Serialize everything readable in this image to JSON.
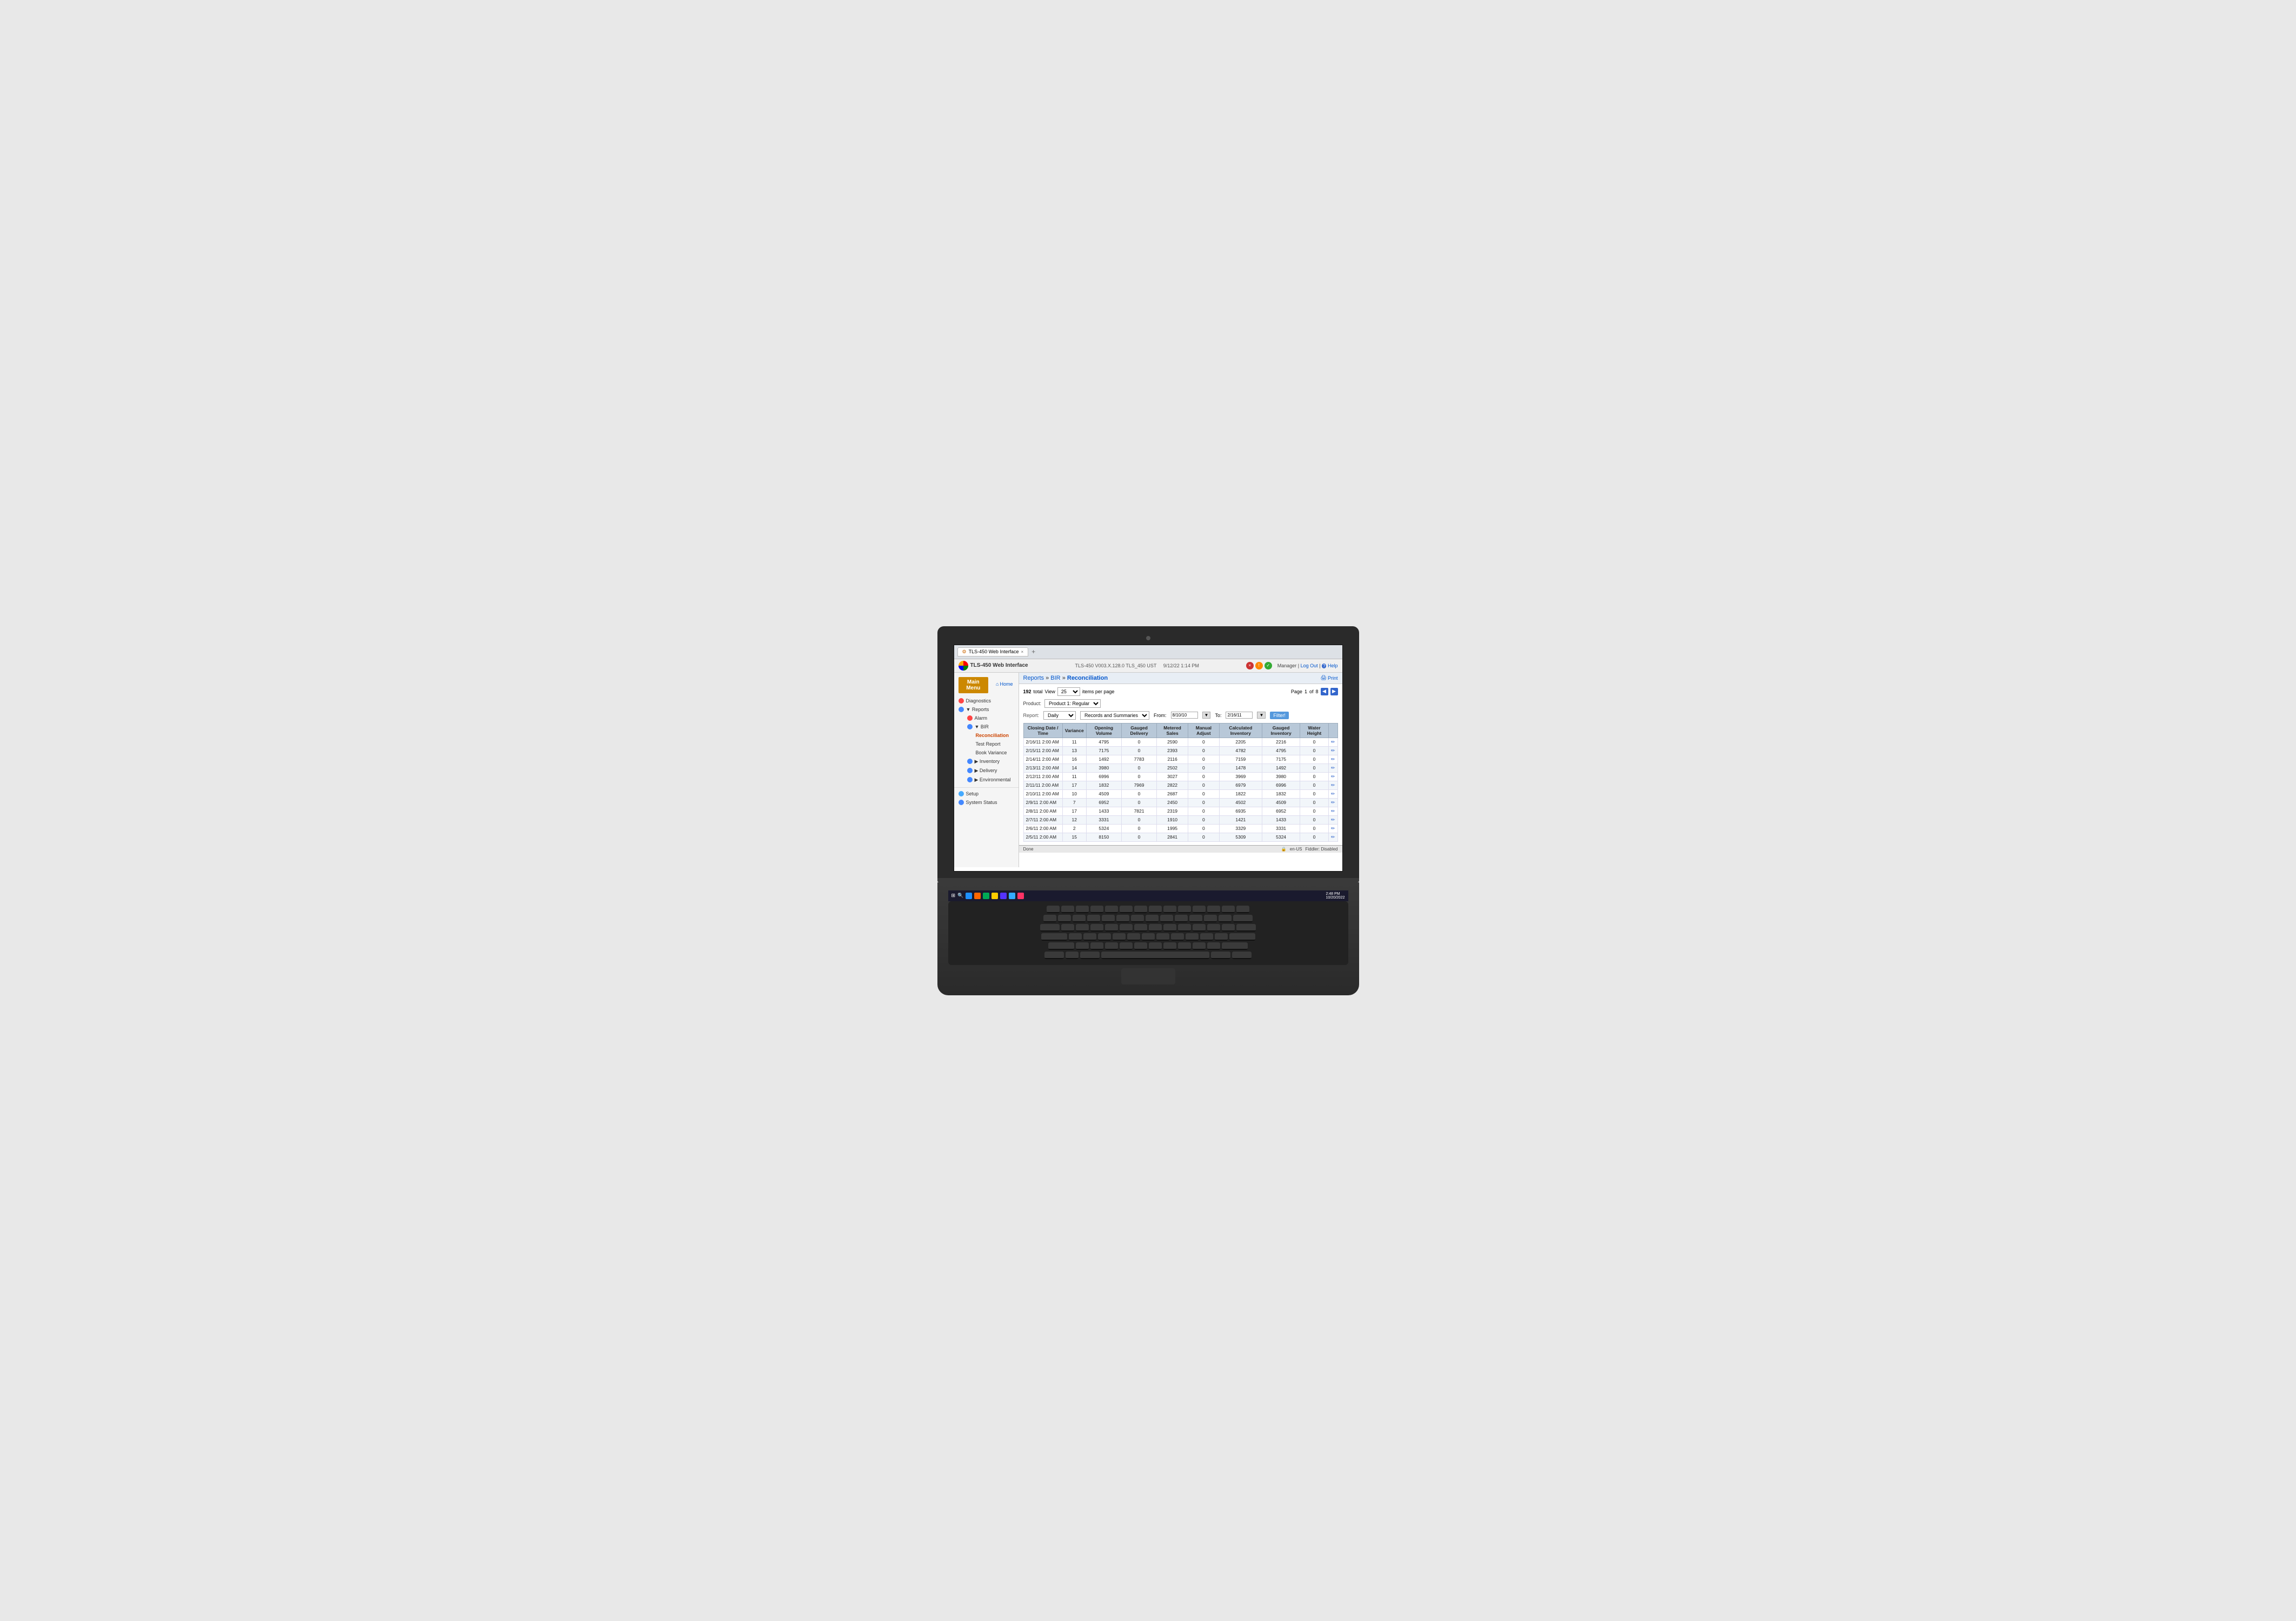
{
  "browser": {
    "tab_title": "TLS-450 Web Interface",
    "new_tab_symbol": "+",
    "close_symbol": "×"
  },
  "appbar": {
    "title": "TLS-450 Web Interface",
    "version": "TLS-450 V003.X.128.0 TLS_450 UST",
    "datetime": "9/12/22 1:14 PM",
    "user": "Manager",
    "separator": "|",
    "logout": "Log Out",
    "help": "Help",
    "help_symbol": "?",
    "status_icons": [
      "×",
      "!",
      "✓"
    ]
  },
  "nav": {
    "main_menu_label": "Main Menu",
    "home_label": "Home",
    "home_icon": "⌂"
  },
  "breadcrumb": {
    "reports": "Reports",
    "bir": "BIR",
    "current": "Reconciliation",
    "arrow": "»"
  },
  "print": {
    "label": "Print",
    "icon": "🖨"
  },
  "sidebar": {
    "items": [
      {
        "label": "Diagnostics",
        "icon": "alarm",
        "has_arrow": false,
        "indent": 0
      },
      {
        "label": "Reports",
        "icon": "reports",
        "has_arrow": true,
        "indent": 0
      },
      {
        "label": "Alarm",
        "icon": "alarm",
        "has_arrow": false,
        "indent": 1
      },
      {
        "label": "BIR",
        "icon": "bir",
        "has_arrow": true,
        "indent": 1
      },
      {
        "label": "Reconciliation",
        "icon": "",
        "has_arrow": false,
        "indent": 2,
        "active": true
      },
      {
        "label": "Test Report",
        "icon": "",
        "has_arrow": false,
        "indent": 2
      },
      {
        "label": "Book Variance",
        "icon": "",
        "has_arrow": false,
        "indent": 2
      },
      {
        "label": "Inventory",
        "icon": "inventory",
        "has_arrow": true,
        "indent": 1
      },
      {
        "label": "Delivery",
        "icon": "delivery",
        "has_arrow": true,
        "indent": 1
      },
      {
        "label": "Environmental",
        "icon": "environmental",
        "has_arrow": true,
        "indent": 1
      },
      {
        "label": "Setup",
        "icon": "setup",
        "has_arrow": false,
        "indent": 0
      },
      {
        "label": "System Status",
        "icon": "system",
        "has_arrow": false,
        "indent": 0
      }
    ]
  },
  "pagination": {
    "total": "192",
    "total_label": "total",
    "view_label": "View",
    "view_value": "25",
    "items_per_page": "items per page",
    "page_label": "Page",
    "page_num": "1",
    "of_label": "of",
    "total_pages": "8"
  },
  "filter": {
    "product_label": "Product:",
    "product_value": "Product 1: Regular",
    "report_label": "Report:",
    "report_value": "Daily",
    "records_label": "Records and Summaries",
    "from_label": "From:",
    "from_value": "8/10/10",
    "to_label": "To:",
    "to_value": "2/16/11",
    "filter_btn": "Filter!"
  },
  "table": {
    "headers": [
      "Closing Date / Time",
      "Variance",
      "Opening Volume",
      "Gauged Delivery",
      "Metered Sales",
      "Manual Adjust",
      "Calculated Inventory",
      "Gauged Inventory",
      "Water Height",
      ""
    ],
    "rows": [
      {
        "date": "2/16/11 2:00 AM",
        "variance": "11",
        "opening": "4795",
        "gauged_del": "0",
        "metered": "2590",
        "manual": "0",
        "calc_inv": "2205",
        "gauged_inv": "2216",
        "water": "0"
      },
      {
        "date": "2/15/11 2:00 AM",
        "variance": "13",
        "opening": "7175",
        "gauged_del": "0",
        "metered": "2393",
        "manual": "0",
        "calc_inv": "4782",
        "gauged_inv": "4795",
        "water": "0"
      },
      {
        "date": "2/14/11 2:00 AM",
        "variance": "16",
        "opening": "1492",
        "gauged_del": "7783",
        "metered": "2116",
        "manual": "0",
        "calc_inv": "7159",
        "gauged_inv": "7175",
        "water": "0"
      },
      {
        "date": "2/13/11 2:00 AM",
        "variance": "14",
        "opening": "3980",
        "gauged_del": "0",
        "metered": "2502",
        "manual": "0",
        "calc_inv": "1478",
        "gauged_inv": "1492",
        "water": "0"
      },
      {
        "date": "2/12/11 2:00 AM",
        "variance": "11",
        "opening": "6996",
        "gauged_del": "0",
        "metered": "3027",
        "manual": "0",
        "calc_inv": "3969",
        "gauged_inv": "3980",
        "water": "0"
      },
      {
        "date": "2/11/11 2:00 AM",
        "variance": "17",
        "opening": "1832",
        "gauged_del": "7969",
        "metered": "2822",
        "manual": "0",
        "calc_inv": "6979",
        "gauged_inv": "6996",
        "water": "0"
      },
      {
        "date": "2/10/11 2:00 AM",
        "variance": "10",
        "opening": "4509",
        "gauged_del": "0",
        "metered": "2687",
        "manual": "0",
        "calc_inv": "1822",
        "gauged_inv": "1832",
        "water": "0"
      },
      {
        "date": "2/9/11 2:00 AM",
        "variance": "7",
        "opening": "6952",
        "gauged_del": "0",
        "metered": "2450",
        "manual": "0",
        "calc_inv": "4502",
        "gauged_inv": "4509",
        "water": "0"
      },
      {
        "date": "2/8/11 2:00 AM",
        "variance": "17",
        "opening": "1433",
        "gauged_del": "7821",
        "metered": "2319",
        "manual": "0",
        "calc_inv": "6935",
        "gauged_inv": "6952",
        "water": "0"
      },
      {
        "date": "2/7/11 2:00 AM",
        "variance": "12",
        "opening": "3331",
        "gauged_del": "0",
        "metered": "1910",
        "manual": "0",
        "calc_inv": "1421",
        "gauged_inv": "1433",
        "water": "0"
      },
      {
        "date": "2/6/11 2:00 AM",
        "variance": "2",
        "opening": "5324",
        "gauged_del": "0",
        "metered": "1995",
        "manual": "0",
        "calc_inv": "3329",
        "gauged_inv": "3331",
        "water": "0"
      },
      {
        "date": "2/5/11 2:00 AM",
        "variance": "15",
        "opening": "8150",
        "gauged_del": "0",
        "metered": "2841",
        "manual": "0",
        "calc_inv": "5309",
        "gauged_inv": "5324",
        "water": "0"
      }
    ]
  },
  "statusbar": {
    "left": "Done",
    "locale": "en-US",
    "app": "Fiddler: Disabled",
    "time": "2:48 PM",
    "date": "10/20/2022"
  },
  "taskbar": {
    "icons": [
      "⊞",
      "🔍",
      "☰"
    ],
    "time": "2:48 PM",
    "date": "10/20/2022"
  }
}
